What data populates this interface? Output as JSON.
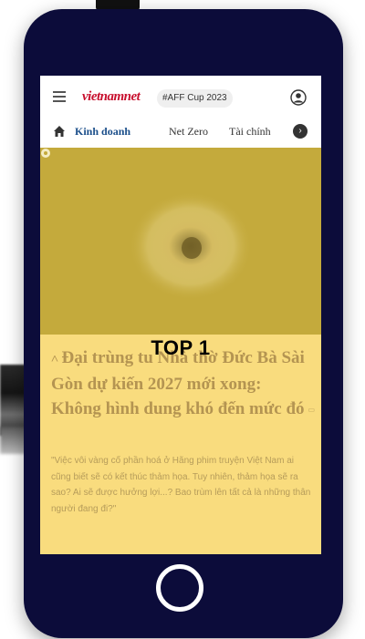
{
  "header": {
    "logo_text": "vietnamnet",
    "hashtag": "#AFF Cup 2023"
  },
  "nav": {
    "items": [
      {
        "label": "Kinh doanh",
        "active": true
      },
      {
        "label": "Net Zero",
        "active": false
      },
      {
        "label": "Tài chính",
        "active": false
      }
    ],
    "more_icon": "chevron-right-icon"
  },
  "article": {
    "rank_label": "TOP 1",
    "headline": "Đại trùng tu Nhà thờ Đức Bà Sài Gòn dự kiến 2027 mới xong: Không hình dung khó đến mức đó",
    "excerpt": "\"Việc vôi vàng cố phần hoá ở Hãng phim truyện Việt Nam ai cũng biết sẽ có kết thúc thảm họa. Tuy nhiên, thảm họa sẽ ra sao? Ai sẽ được hưởng lợi...? Bao trùm lên tất cả là những thân người đang đi?\"",
    "hero_color": "#c4aa3c",
    "body_color": "#f9dc7e"
  },
  "device": {
    "frame_color": "#0c0c3a"
  }
}
